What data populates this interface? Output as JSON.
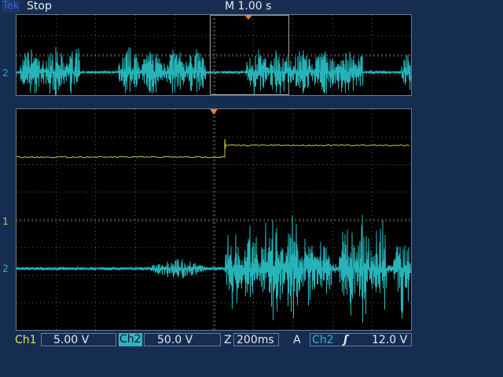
{
  "header": {
    "brand": "Tek",
    "run_state": "Stop",
    "timebase": "M 1.00 s"
  },
  "channels": {
    "ch1_marker": "1",
    "ch2_marker": "2",
    "ch1_color": "#c8c832",
    "ch2_color": "#26b3b8"
  },
  "status": {
    "ch1_label": "Ch1",
    "ch1_scale": "5.00 V",
    "ch2_label": "Ch2",
    "ch2_scale": "50.0 V",
    "zoom_label": "Z",
    "zoom_scale": "200ms",
    "trigger_label": "A",
    "trigger_source": "Ch2",
    "trigger_slope": "ʃ",
    "trigger_level": "12.0 V"
  },
  "colors": {
    "background": "#162d52",
    "grid": "#5a5a5a",
    "trigger_marker": "#f08020"
  }
}
